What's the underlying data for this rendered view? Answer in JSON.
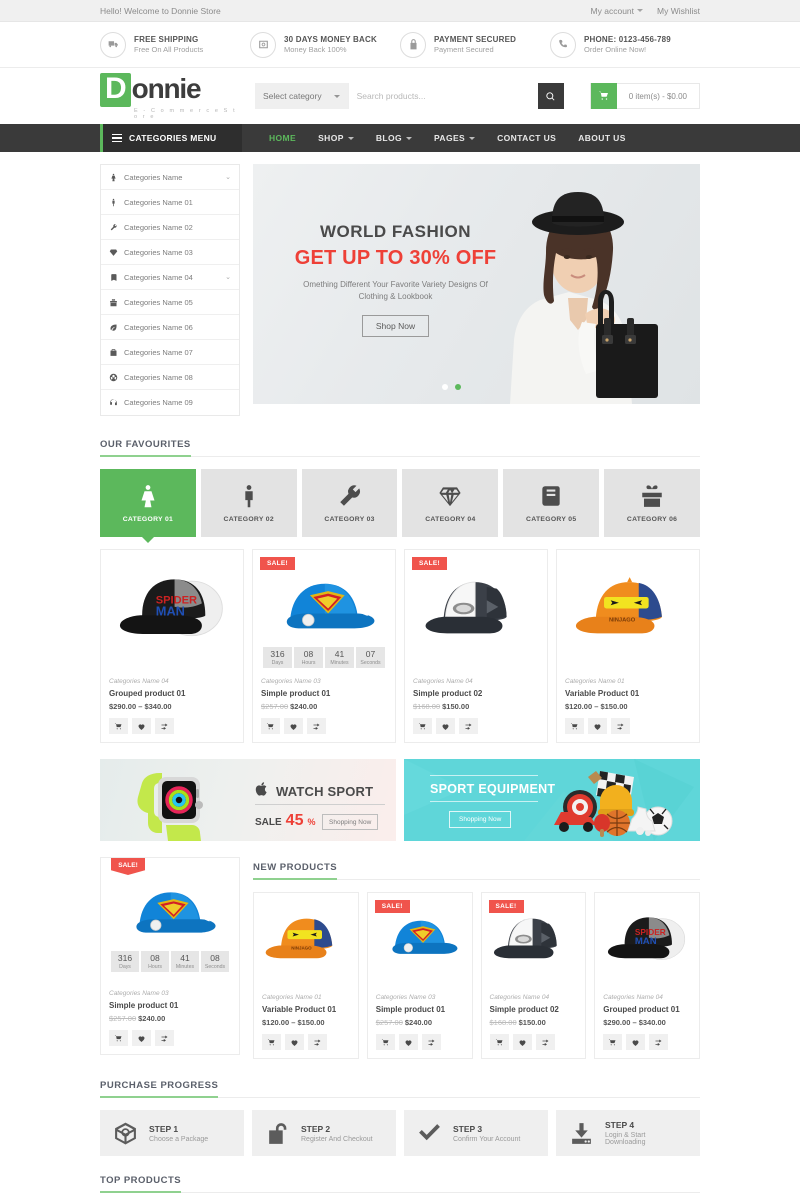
{
  "topbar": {
    "welcome": "Hello! Welcome to Donnie Store",
    "links": [
      {
        "label": "My account",
        "caret": true,
        "icon": "chevron-down-icon"
      },
      {
        "label": "My Wishlist",
        "caret": false,
        "icon": ""
      }
    ]
  },
  "services": [
    {
      "icon": "truck-icon",
      "title": "FREE SHIPPING",
      "sub": "Free On All Products"
    },
    {
      "icon": "money-icon",
      "title": "30 DAYS MONEY BACK",
      "sub": "Money Back 100%"
    },
    {
      "icon": "lock-icon",
      "title": "PAYMENT SECURED",
      "sub": "Payment Secured"
    },
    {
      "icon": "phone-icon",
      "title": "PHONE: 0123-456-789",
      "sub": "Order Online Now!"
    }
  ],
  "logo": {
    "initial": "D",
    "rest": "onnie",
    "tagline": "E - C o m m e r c e   S t o r e"
  },
  "search": {
    "category_label": "Select category",
    "placeholder": "Search products...",
    "value": "",
    "button_icon": "search-icon"
  },
  "cart": {
    "icon": "cart-icon",
    "text": "0 item(s) - $0.00"
  },
  "nav": {
    "categories_label": "CATEGORIES MENU",
    "items": [
      {
        "label": "HOME",
        "active": true,
        "caret": false
      },
      {
        "label": "SHOP",
        "active": false,
        "caret": true
      },
      {
        "label": "BLOG",
        "active": false,
        "caret": true
      },
      {
        "label": "PAGES",
        "active": false,
        "caret": true
      },
      {
        "label": "CONTACT US",
        "active": false,
        "caret": false
      },
      {
        "label": "ABOUT US",
        "active": false,
        "caret": false
      }
    ]
  },
  "sidebar": {
    "items": [
      {
        "label": "Categories Name",
        "icon": "female-icon",
        "chevron": true
      },
      {
        "label": "Categories Name 01",
        "icon": "male-icon",
        "chevron": false
      },
      {
        "label": "Categories Name 02",
        "icon": "wrench-icon",
        "chevron": false
      },
      {
        "label": "Categories Name 03",
        "icon": "diamond-icon",
        "chevron": false
      },
      {
        "label": "Categories Name 04",
        "icon": "book-icon",
        "chevron": true
      },
      {
        "label": "Categories Name 05",
        "icon": "gift-icon",
        "chevron": false
      },
      {
        "label": "Categories Name 06",
        "icon": "leaf-icon",
        "chevron": false
      },
      {
        "label": "Categories Name 07",
        "icon": "briefcase-icon",
        "chevron": false
      },
      {
        "label": "Categories Name 08",
        "icon": "soccer-ball-icon",
        "chevron": false
      },
      {
        "label": "Categories Name 09",
        "icon": "headphones-icon",
        "chevron": false
      }
    ]
  },
  "hero": {
    "heading": "WORLD FASHION",
    "subheading": "GET UP TO 30% OFF",
    "description": "Omething Different Your Favorite Variety Designs Of Clothing & Lookbook",
    "button": "Shop Now",
    "dots": [
      {
        "active": false
      },
      {
        "active": true
      }
    ],
    "accent_color": "#ee4037"
  },
  "favourites": {
    "title": "OUR FAVOURITES",
    "tabs": [
      {
        "label": "CATEGORY 01",
        "icon": "female-icon",
        "active": true
      },
      {
        "label": "CATEGORY 02",
        "icon": "male-icon",
        "active": false
      },
      {
        "label": "CATEGORY 03",
        "icon": "wrench-icon",
        "active": false
      },
      {
        "label": "CATEGORY 04",
        "icon": "diamond-icon",
        "active": false
      },
      {
        "label": "CATEGORY 05",
        "icon": "book-icon",
        "active": false
      },
      {
        "label": "CATEGORY 06",
        "icon": "gift-icon",
        "active": false
      }
    ],
    "products": [
      {
        "sale": false,
        "badge": "",
        "category": "Categories Name 04",
        "name": "Grouped product 01",
        "old_price": "",
        "price": "$290.00 – $340.00",
        "image": "spiderman-cap",
        "countdown": null
      },
      {
        "sale": true,
        "badge": "SALE!",
        "category": "Categories Name 03",
        "name": "Simple product 01",
        "old_price": "$257.00",
        "price": "$240.00",
        "image": "superman-cap",
        "countdown": {
          "days": "316",
          "hours": "08",
          "minutes": "41",
          "seconds": "07",
          "labels": [
            "Days",
            "Hours",
            "Minutes",
            "Seconds"
          ]
        }
      },
      {
        "sale": true,
        "badge": "SALE!",
        "category": "Categories Name 04",
        "name": "Simple product 02",
        "old_price": "$168.00",
        "price": "$150.00",
        "image": "white-trucker-cap",
        "countdown": null
      },
      {
        "sale": false,
        "badge": "",
        "category": "Categories Name 01",
        "name": "Variable Product 01",
        "old_price": "",
        "price": "$120.00 – $150.00",
        "image": "ninjago-cap",
        "countdown": null
      }
    ]
  },
  "promos": [
    {
      "id": "watch-sport",
      "brand_icon": "apple-icon",
      "title": "WATCH SPORT",
      "sale_prefix": "SALE",
      "sale_value": "45",
      "sale_unit": "%",
      "button": "Shopping Now"
    },
    {
      "id": "sport-equipment",
      "title": "SPORT EQUIPMENT",
      "button": "Shopping Now"
    }
  ],
  "featured": {
    "badge": "SALE!",
    "category": "Categories Name 03",
    "name": "Simple product 01",
    "old_price": "$257.00",
    "price": "$240.00",
    "image": "superman-cap",
    "countdown": {
      "days": "316",
      "hours": "08",
      "minutes": "41",
      "seconds": "08",
      "labels": [
        "Days",
        "Hours",
        "Minutes",
        "Seconds"
      ]
    }
  },
  "new_products": {
    "title": "NEW PRODUCTS",
    "products": [
      {
        "sale": false,
        "badge": "",
        "category": "Categories Name 01",
        "name": "Variable Product 01",
        "old_price": "",
        "price": "$120.00 – $150.00",
        "image": "ninjago-cap"
      },
      {
        "sale": true,
        "badge": "SALE!",
        "category": "Categories Name 03",
        "name": "Simple product 01",
        "old_price": "$257.00",
        "price": "$240.00",
        "image": "superman-cap"
      },
      {
        "sale": true,
        "badge": "SALE!",
        "category": "Categories Name 04",
        "name": "Simple product 02",
        "old_price": "$168.00",
        "price": "$150.00",
        "image": "white-trucker-cap"
      },
      {
        "sale": false,
        "badge": "",
        "category": "Categories Name 04",
        "name": "Grouped product 01",
        "old_price": "",
        "price": "$290.00 – $340.00",
        "image": "spiderman-cap"
      }
    ]
  },
  "purchase_progress": {
    "title": "PURCHASE PROGRESS",
    "steps": [
      {
        "icon": "package-icon",
        "title": "STEP 1",
        "desc": "Choose a Package"
      },
      {
        "icon": "unlock-icon",
        "title": "STEP 2",
        "desc": "Register And Checkout"
      },
      {
        "icon": "check-icon",
        "title": "STEP 3",
        "desc": "Confirm Your Account"
      },
      {
        "icon": "download-icon",
        "title": "STEP 4",
        "desc": "Login & Start Downloading"
      }
    ]
  },
  "top_products": {
    "title": "TOP PRODUCTS"
  },
  "product_actions": [
    {
      "icon": "cart-icon",
      "name": "add-to-cart"
    },
    {
      "icon": "heart-icon",
      "name": "add-to-wishlist"
    },
    {
      "icon": "compare-icon",
      "name": "compare"
    }
  ],
  "colors": {
    "accent": "#5cb85c",
    "sale": "#f0544c",
    "dark": "#3a3a3a",
    "red": "#ee4037",
    "teal": "#5fd6d9"
  }
}
